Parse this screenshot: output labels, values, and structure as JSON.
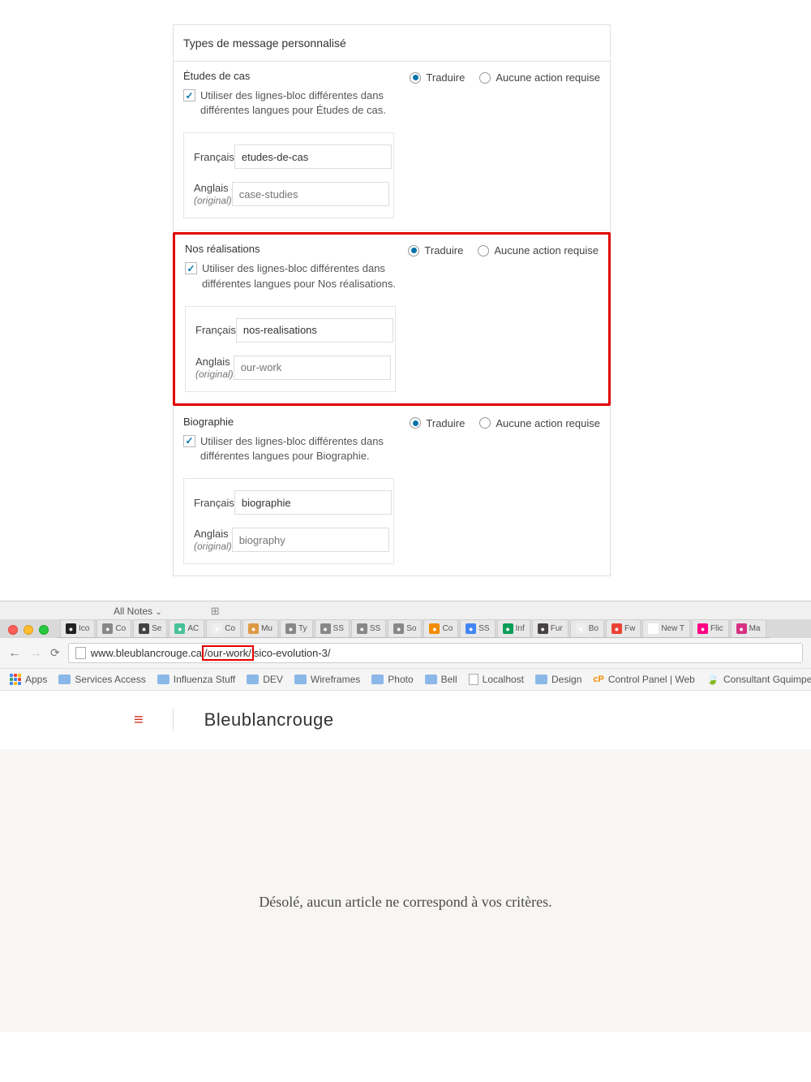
{
  "panel": {
    "header": "Types de message personnalisé",
    "radio_translate": "Traduire",
    "radio_noaction": "Aucune action requise",
    "lang_a": "Français",
    "lang_b": "Anglais",
    "lang_b_sub": "(original)",
    "sections": [
      {
        "title": "Études de cas",
        "check_text": "Utiliser des lignes-bloc différentes dans différentes langues pour Études de cas.",
        "slug_a": "etudes-de-cas",
        "slug_b": "case-studies",
        "highlighted": false
      },
      {
        "title": "Nos réalisations",
        "check_text": "Utiliser des lignes-bloc différentes dans différentes langues pour Nos réalisations.",
        "slug_a": "nos-realisations",
        "slug_b": "our-work",
        "highlighted": true
      },
      {
        "title": "Biographie",
        "check_text": "Utiliser des lignes-bloc différentes dans différentes langues pour Biographie.",
        "slug_a": "biographie",
        "slug_b": "biography",
        "highlighted": false
      }
    ]
  },
  "strip": {
    "all_notes": "All Notes"
  },
  "tabs": [
    {
      "label": "Ico",
      "bg": "#222"
    },
    {
      "label": "Co",
      "bg": "#888"
    },
    {
      "label": "Se",
      "bg": "#444"
    },
    {
      "label": "AC",
      "bg": "#49c19a"
    },
    {
      "label": "Co",
      "bg": "#eee"
    },
    {
      "label": "Mu",
      "bg": "#d94"
    },
    {
      "label": "Ty",
      "bg": "#888"
    },
    {
      "label": "SS",
      "bg": "#888"
    },
    {
      "label": "SS",
      "bg": "#888"
    },
    {
      "label": "So",
      "bg": "#888"
    },
    {
      "label": "Co",
      "bg": "#f28c00"
    },
    {
      "label": "SS",
      "bg": "#4285f4"
    },
    {
      "label": "Inf",
      "bg": "#0f9d58"
    },
    {
      "label": "Fur",
      "bg": "#464342"
    },
    {
      "label": "Bo",
      "bg": "#eee"
    },
    {
      "label": "Fw",
      "bg": "#ea4335"
    },
    {
      "label": "New T",
      "bg": "#fff"
    },
    {
      "label": "Flic",
      "bg": "#ff0084"
    },
    {
      "label": "Ma",
      "bg": "#d63384"
    }
  ],
  "url": {
    "pre": "www.bleublancrouge.ca",
    "mid": "/our-work/",
    "post": "sico-evolution-3/"
  },
  "bookmarks": {
    "apps": "Apps",
    "items": [
      "Services Access",
      "Influenza Stuff",
      "DEV",
      "Wireframes",
      "Photo",
      "Bell"
    ],
    "localhost": "Localhost",
    "design": "Design",
    "control": "Control Panel | Web",
    "consult": "Consultant Gquimpe"
  },
  "page": {
    "title": "Bleublancrouge",
    "noresults": "Désolé, aucun article ne correspond à vos critères."
  }
}
